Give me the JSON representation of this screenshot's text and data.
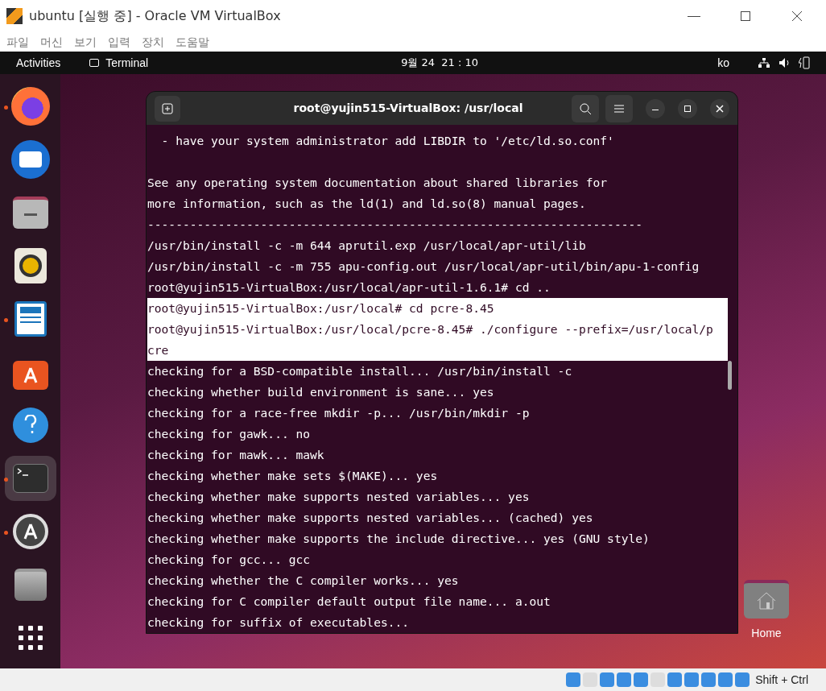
{
  "window": {
    "title": "ubuntu [실행 중] - Oracle VM VirtualBox"
  },
  "menu": [
    "파일",
    "머신",
    "보기",
    "입력",
    "장치",
    "도움말"
  ],
  "top_bar": {
    "activities": "Activities",
    "app": "Terminal",
    "clock": "9월 24  21 : 10",
    "input_method": "ko"
  },
  "dock": [
    {
      "kind": "firefox",
      "running": true,
      "active": false
    },
    {
      "kind": "thunderbird",
      "running": false,
      "active": false
    },
    {
      "kind": "files",
      "running": false,
      "active": false
    },
    {
      "kind": "rhythmbox",
      "running": false,
      "active": false
    },
    {
      "kind": "writer",
      "running": true,
      "active": false
    },
    {
      "kind": "store",
      "running": false,
      "active": false
    },
    {
      "kind": "help",
      "running": false,
      "active": false
    },
    {
      "kind": "terminal",
      "running": true,
      "active": true
    },
    {
      "kind": "updater",
      "running": true,
      "active": false
    },
    {
      "kind": "trash",
      "running": false,
      "active": false
    },
    {
      "kind": "apps",
      "running": false,
      "active": false
    }
  ],
  "terminal": {
    "title": "root@yujin515-VirtualBox: /usr/local",
    "lines": [
      {
        "text": "  - have your system administrator add LIBDIR to '/etc/ld.so.conf'",
        "selected": false
      },
      {
        "selected": false
      },
      {
        "text": "See any operating system documentation about shared libraries for",
        "selected": false
      },
      {
        "text": "more information, such as the ld(1) and ld.so(8) manual pages.",
        "selected": false
      },
      {
        "text": "----------------------------------------------------------------------",
        "selected": false
      },
      {
        "text": "/usr/bin/install -c -m 644 aprutil.exp /usr/local/apr-util/lib",
        "selected": false
      },
      {
        "text": "/usr/bin/install -c -m 755 apu-config.out /usr/local/apr-util/bin/apu-1-config",
        "selected": false
      },
      {
        "text": "root@yujin515-VirtualBox:/usr/local/apr-util-1.6.1# cd ..",
        "selected": false
      },
      {
        "text": "root@yujin515-VirtualBox:/usr/local# cd pcre-8.45",
        "selected": true
      },
      {
        "text": "root@yujin515-VirtualBox:/usr/local/pcre-8.45# ./configure --prefix=/usr/local/p",
        "selected": true
      },
      {
        "text": "cre",
        "selected": true
      },
      {
        "text": "checking for a BSD-compatible install... /usr/bin/install -c",
        "selected": false
      },
      {
        "text": "checking whether build environment is sane... yes",
        "selected": false
      },
      {
        "text": "checking for a race-free mkdir -p... /usr/bin/mkdir -p",
        "selected": false
      },
      {
        "text": "checking for gawk... no",
        "selected": false
      },
      {
        "text": "checking for mawk... mawk",
        "selected": false
      },
      {
        "text": "checking whether make sets $(MAKE)... yes",
        "selected": false
      },
      {
        "text": "checking whether make supports nested variables... yes",
        "selected": false
      },
      {
        "text": "checking whether make supports nested variables... (cached) yes",
        "selected": false
      },
      {
        "text": "checking whether make supports the include directive... yes (GNU style)",
        "selected": false
      },
      {
        "text": "checking for gcc... gcc",
        "selected": false
      },
      {
        "text": "checking whether the C compiler works... yes",
        "selected": false
      },
      {
        "text": "checking for C compiler default output file name... a.out",
        "selected": false
      },
      {
        "text": "checking for suffix of executables...",
        "selected": false
      }
    ]
  },
  "desktop_icons": [
    {
      "label": "Home"
    }
  ],
  "status_bar": {
    "host_key": "Shift + Ctrl"
  }
}
